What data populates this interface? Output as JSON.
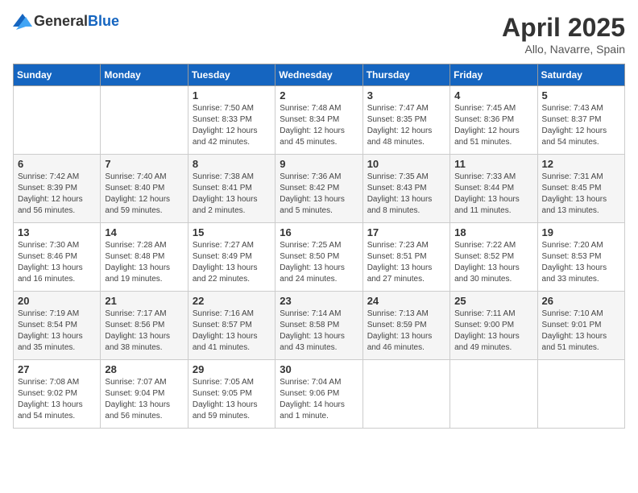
{
  "header": {
    "logo_general": "General",
    "logo_blue": "Blue",
    "month_title": "April 2025",
    "location": "Allo, Navarre, Spain"
  },
  "days_of_week": [
    "Sunday",
    "Monday",
    "Tuesday",
    "Wednesday",
    "Thursday",
    "Friday",
    "Saturday"
  ],
  "weeks": [
    [
      {
        "day": "",
        "info": ""
      },
      {
        "day": "",
        "info": ""
      },
      {
        "day": "1",
        "info": "Sunrise: 7:50 AM\nSunset: 8:33 PM\nDaylight: 12 hours and 42 minutes."
      },
      {
        "day": "2",
        "info": "Sunrise: 7:48 AM\nSunset: 8:34 PM\nDaylight: 12 hours and 45 minutes."
      },
      {
        "day": "3",
        "info": "Sunrise: 7:47 AM\nSunset: 8:35 PM\nDaylight: 12 hours and 48 minutes."
      },
      {
        "day": "4",
        "info": "Sunrise: 7:45 AM\nSunset: 8:36 PM\nDaylight: 12 hours and 51 minutes."
      },
      {
        "day": "5",
        "info": "Sunrise: 7:43 AM\nSunset: 8:37 PM\nDaylight: 12 hours and 54 minutes."
      }
    ],
    [
      {
        "day": "6",
        "info": "Sunrise: 7:42 AM\nSunset: 8:39 PM\nDaylight: 12 hours and 56 minutes."
      },
      {
        "day": "7",
        "info": "Sunrise: 7:40 AM\nSunset: 8:40 PM\nDaylight: 12 hours and 59 minutes."
      },
      {
        "day": "8",
        "info": "Sunrise: 7:38 AM\nSunset: 8:41 PM\nDaylight: 13 hours and 2 minutes."
      },
      {
        "day": "9",
        "info": "Sunrise: 7:36 AM\nSunset: 8:42 PM\nDaylight: 13 hours and 5 minutes."
      },
      {
        "day": "10",
        "info": "Sunrise: 7:35 AM\nSunset: 8:43 PM\nDaylight: 13 hours and 8 minutes."
      },
      {
        "day": "11",
        "info": "Sunrise: 7:33 AM\nSunset: 8:44 PM\nDaylight: 13 hours and 11 minutes."
      },
      {
        "day": "12",
        "info": "Sunrise: 7:31 AM\nSunset: 8:45 PM\nDaylight: 13 hours and 13 minutes."
      }
    ],
    [
      {
        "day": "13",
        "info": "Sunrise: 7:30 AM\nSunset: 8:46 PM\nDaylight: 13 hours and 16 minutes."
      },
      {
        "day": "14",
        "info": "Sunrise: 7:28 AM\nSunset: 8:48 PM\nDaylight: 13 hours and 19 minutes."
      },
      {
        "day": "15",
        "info": "Sunrise: 7:27 AM\nSunset: 8:49 PM\nDaylight: 13 hours and 22 minutes."
      },
      {
        "day": "16",
        "info": "Sunrise: 7:25 AM\nSunset: 8:50 PM\nDaylight: 13 hours and 24 minutes."
      },
      {
        "day": "17",
        "info": "Sunrise: 7:23 AM\nSunset: 8:51 PM\nDaylight: 13 hours and 27 minutes."
      },
      {
        "day": "18",
        "info": "Sunrise: 7:22 AM\nSunset: 8:52 PM\nDaylight: 13 hours and 30 minutes."
      },
      {
        "day": "19",
        "info": "Sunrise: 7:20 AM\nSunset: 8:53 PM\nDaylight: 13 hours and 33 minutes."
      }
    ],
    [
      {
        "day": "20",
        "info": "Sunrise: 7:19 AM\nSunset: 8:54 PM\nDaylight: 13 hours and 35 minutes."
      },
      {
        "day": "21",
        "info": "Sunrise: 7:17 AM\nSunset: 8:56 PM\nDaylight: 13 hours and 38 minutes."
      },
      {
        "day": "22",
        "info": "Sunrise: 7:16 AM\nSunset: 8:57 PM\nDaylight: 13 hours and 41 minutes."
      },
      {
        "day": "23",
        "info": "Sunrise: 7:14 AM\nSunset: 8:58 PM\nDaylight: 13 hours and 43 minutes."
      },
      {
        "day": "24",
        "info": "Sunrise: 7:13 AM\nSunset: 8:59 PM\nDaylight: 13 hours and 46 minutes."
      },
      {
        "day": "25",
        "info": "Sunrise: 7:11 AM\nSunset: 9:00 PM\nDaylight: 13 hours and 49 minutes."
      },
      {
        "day": "26",
        "info": "Sunrise: 7:10 AM\nSunset: 9:01 PM\nDaylight: 13 hours and 51 minutes."
      }
    ],
    [
      {
        "day": "27",
        "info": "Sunrise: 7:08 AM\nSunset: 9:02 PM\nDaylight: 13 hours and 54 minutes."
      },
      {
        "day": "28",
        "info": "Sunrise: 7:07 AM\nSunset: 9:04 PM\nDaylight: 13 hours and 56 minutes."
      },
      {
        "day": "29",
        "info": "Sunrise: 7:05 AM\nSunset: 9:05 PM\nDaylight: 13 hours and 59 minutes."
      },
      {
        "day": "30",
        "info": "Sunrise: 7:04 AM\nSunset: 9:06 PM\nDaylight: 14 hours and 1 minute."
      },
      {
        "day": "",
        "info": ""
      },
      {
        "day": "",
        "info": ""
      },
      {
        "day": "",
        "info": ""
      }
    ]
  ]
}
